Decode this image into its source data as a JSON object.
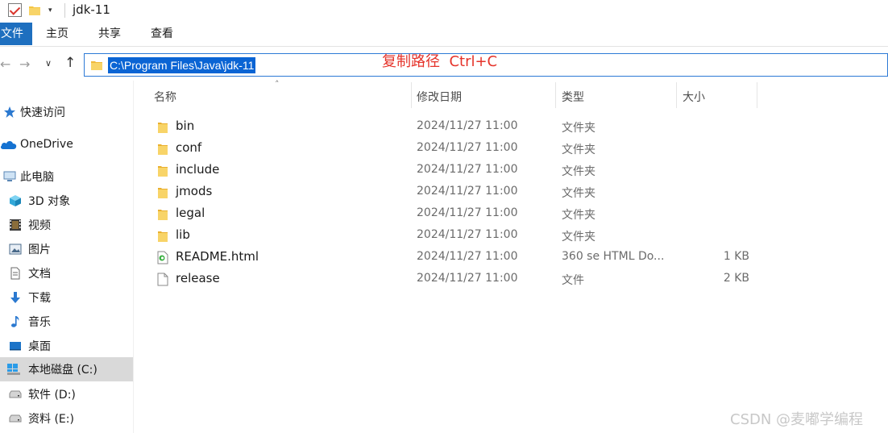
{
  "window": {
    "title": "jdk-11",
    "quick_access_dropdown": "▾"
  },
  "ribbon": {
    "tabs": [
      "文件",
      "主页",
      "共享",
      "查看"
    ]
  },
  "address_bar": {
    "path": "C:\\Program Files\\Java\\jdk-11"
  },
  "annotation": "复制路径  Ctrl+C",
  "sidebar": {
    "items": [
      {
        "label": "快速访问",
        "icon": "star-icon"
      },
      {
        "label": "OneDrive",
        "icon": "cloud-icon"
      },
      {
        "label": "此电脑",
        "icon": "computer-icon"
      },
      {
        "label": "3D 对象",
        "icon": "cube-icon"
      },
      {
        "label": "视频",
        "icon": "video-icon"
      },
      {
        "label": "图片",
        "icon": "picture-icon"
      },
      {
        "label": "文档",
        "icon": "document-icon"
      },
      {
        "label": "下载",
        "icon": "download-icon"
      },
      {
        "label": "音乐",
        "icon": "music-icon"
      },
      {
        "label": "桌面",
        "icon": "desktop-icon"
      },
      {
        "label": "本地磁盘 (C:)",
        "icon": "windows-drive-icon",
        "selected": true
      },
      {
        "label": "软件 (D:)",
        "icon": "drive-icon"
      },
      {
        "label": "资料 (E:)",
        "icon": "drive-icon"
      }
    ]
  },
  "columns": {
    "name": "名称",
    "modified": "修改日期",
    "type": "类型",
    "size": "大小"
  },
  "files": [
    {
      "name": "bin",
      "modified": "2024/11/27 11:00",
      "type": "文件夹",
      "size": "",
      "icon": "folder-icon"
    },
    {
      "name": "conf",
      "modified": "2024/11/27 11:00",
      "type": "文件夹",
      "size": "",
      "icon": "folder-icon"
    },
    {
      "name": "include",
      "modified": "2024/11/27 11:00",
      "type": "文件夹",
      "size": "",
      "icon": "folder-icon"
    },
    {
      "name": "jmods",
      "modified": "2024/11/27 11:00",
      "type": "文件夹",
      "size": "",
      "icon": "folder-icon"
    },
    {
      "name": "legal",
      "modified": "2024/11/27 11:00",
      "type": "文件夹",
      "size": "",
      "icon": "folder-icon"
    },
    {
      "name": "lib",
      "modified": "2024/11/27 11:00",
      "type": "文件夹",
      "size": "",
      "icon": "folder-icon"
    },
    {
      "name": "README.html",
      "modified": "2024/11/27 11:00",
      "type": "360 se HTML Do...",
      "size": "1 KB",
      "icon": "html-file-icon"
    },
    {
      "name": "release",
      "modified": "2024/11/27 11:00",
      "type": "文件",
      "size": "2 KB",
      "icon": "file-icon"
    }
  ],
  "watermark": "CSDN @麦嘟学编程",
  "colors": {
    "accent": "#1e6fbf",
    "selection": "#0a64d4",
    "annotation": "#e5332a",
    "folder": "#f5c542"
  }
}
